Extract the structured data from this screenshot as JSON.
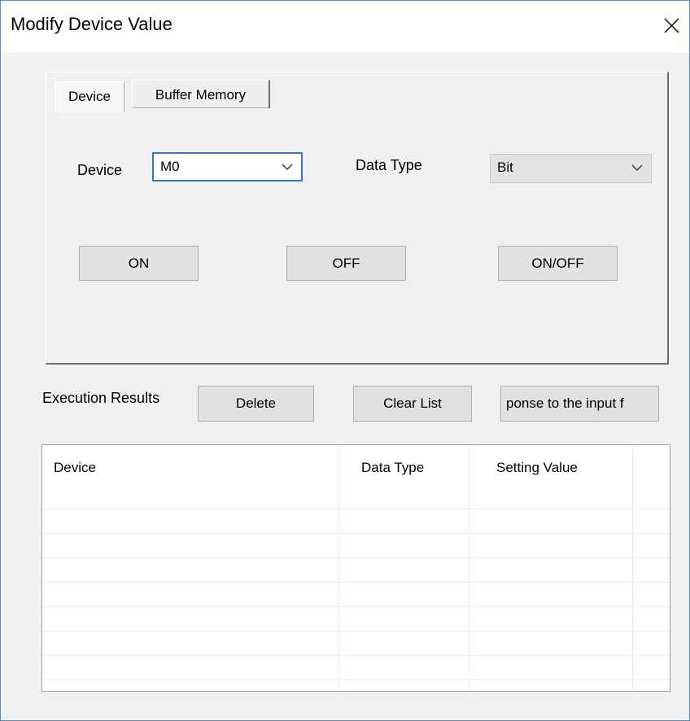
{
  "window": {
    "title": "Modify Device Value"
  },
  "tabs": [
    {
      "label": "Device",
      "selected": true
    },
    {
      "label": "Buffer Memory",
      "selected": false
    }
  ],
  "form": {
    "device_label": "Device",
    "device_value": "M0",
    "data_type_label": "Data Type",
    "data_type_value": "Bit"
  },
  "actions": {
    "on": "ON",
    "off": "OFF",
    "on_off": "ON/OFF"
  },
  "results": {
    "label": "Execution Results",
    "delete": "Delete",
    "clear_list": "Clear List",
    "response": "ponse to the input f"
  },
  "table": {
    "columns": [
      "Device",
      "Data Type",
      "Setting Value"
    ],
    "rows": []
  },
  "colors": {
    "accent": "#2c78d1",
    "window_border": "#4b8fd4"
  },
  "icons": [
    "close-icon",
    "chevron-down-icon"
  ]
}
